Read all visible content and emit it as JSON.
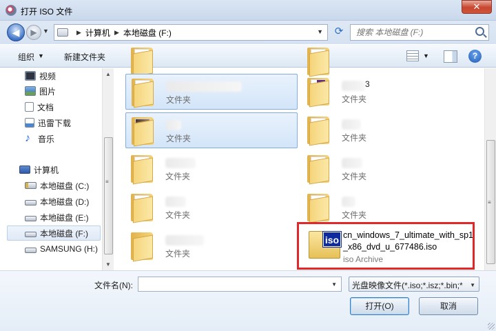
{
  "window": {
    "title": "打开 ISO 文件",
    "close_label": "✕"
  },
  "nav": {
    "breadcrumb": [
      "计算机",
      "本地磁盘 (F:)"
    ],
    "search_placeholder": "搜索 本地磁盘 (F:)"
  },
  "toolbar": {
    "organize_label": "组织",
    "new_folder_label": "新建文件夹",
    "help_label": "?"
  },
  "sidebar": {
    "items": [
      {
        "label": "视频",
        "icon": "video-icon"
      },
      {
        "label": "图片",
        "icon": "picture-icon"
      },
      {
        "label": "文档",
        "icon": "document-icon"
      },
      {
        "label": "迅雷下载",
        "icon": "download-folder-icon"
      },
      {
        "label": "音乐",
        "icon": "music-icon"
      },
      {
        "label": "计算机",
        "icon": "computer-icon"
      },
      {
        "label": "本地磁盘 (C:)",
        "icon": "system-drive-icon"
      },
      {
        "label": "本地磁盘 (D:)",
        "icon": "drive-icon"
      },
      {
        "label": "本地磁盘 (E:)",
        "icon": "drive-icon"
      },
      {
        "label": "本地磁盘 (F:)",
        "icon": "drive-icon"
      },
      {
        "label": "SAMSUNG (H:)",
        "icon": "drive-icon"
      }
    ]
  },
  "files": {
    "folder_type": "文件夹",
    "partial_name": "3",
    "iso": {
      "name": "cn_windows_7_ultimate_with_sp1_x86_dvd_u_677486.iso",
      "type": "iso Archive",
      "badge": "iso"
    }
  },
  "footer": {
    "filename_label": "文件名(N):",
    "filename_value": "",
    "filter_label": "光盘映像文件(*.iso;*.isz;*.bin;*",
    "open_label": "打开(O)",
    "cancel_label": "取消"
  }
}
